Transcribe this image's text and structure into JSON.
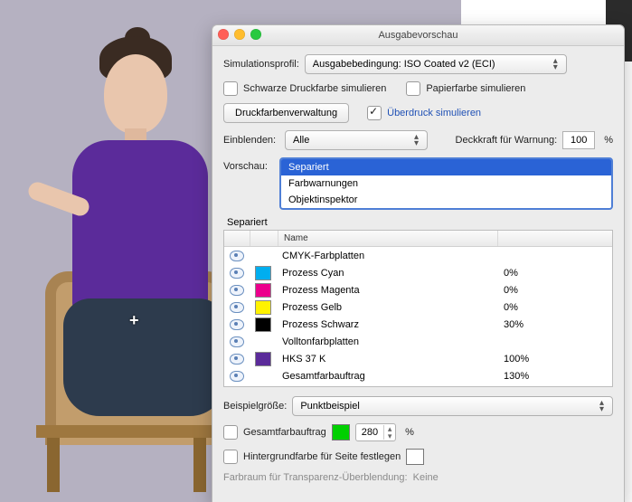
{
  "window": {
    "title": "Ausgabevorschau"
  },
  "sim": {
    "label": "Simulationsprofil:",
    "value": "Ausgabebedingung: ISO Coated v2 (ECI)"
  },
  "checks": {
    "black_ink": "Schwarze Druckfarbe simulieren",
    "paper": "Papierfarbe simulieren",
    "overprint": "Überdruck simulieren"
  },
  "buttons": {
    "ink_manager": "Druckfarbenverwaltung"
  },
  "show": {
    "label": "Einblenden:",
    "value": "Alle",
    "warn_label": "Deckkraft für Warnung:",
    "warn_value": "100",
    "pct": "%"
  },
  "preview": {
    "label": "Vorschau:",
    "options": [
      "Separiert",
      "Farbwarnungen",
      "Objektinspektor"
    ],
    "selected": 0
  },
  "separations": {
    "title": "Separiert",
    "name_col": "Name",
    "rows": [
      {
        "swatch": null,
        "name": "CMYK-Farbplatten",
        "value": ""
      },
      {
        "swatch": "#00aeef",
        "name": "Prozess Cyan",
        "value": "0%"
      },
      {
        "swatch": "#ec008c",
        "name": "Prozess Magenta",
        "value": "0%"
      },
      {
        "swatch": "#fff200",
        "name": "Prozess Gelb",
        "value": "0%"
      },
      {
        "swatch": "#000000",
        "name": "Prozess Schwarz",
        "value": "30%"
      },
      {
        "swatch": null,
        "name": "Volltonfarbplatten",
        "value": ""
      },
      {
        "swatch": "#5b2b9a",
        "name": "HKS 37 K",
        "value": "100%"
      },
      {
        "swatch": null,
        "name": "Gesamtfarbauftrag",
        "value": "130%"
      }
    ]
  },
  "sample": {
    "label": "Beispielgröße:",
    "value": "Punktbeispiel"
  },
  "total_ink": {
    "label": "Gesamtfarbauftrag",
    "value": "280",
    "pct": "%",
    "swatch": "#00d000"
  },
  "page_bg": {
    "label": "Hintergrundfarbe für Seite festlegen"
  },
  "transparency": {
    "label": "Farbraum für Transparenz-Überblendung:",
    "value": "Keine"
  }
}
